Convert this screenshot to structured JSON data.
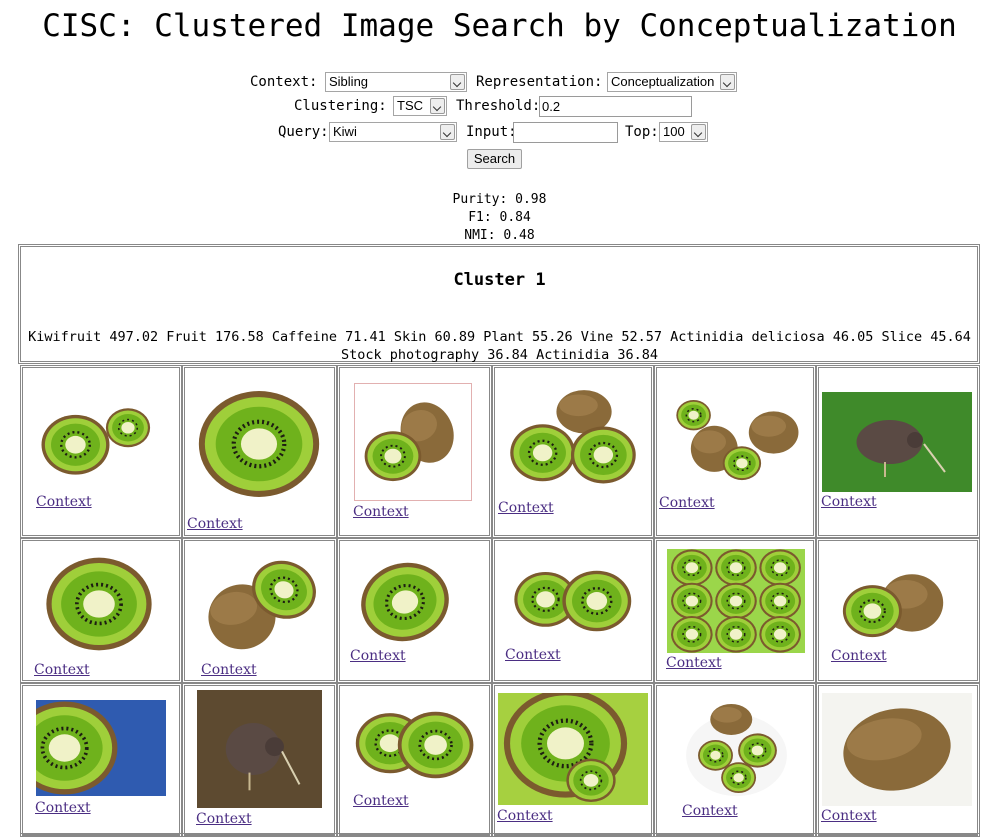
{
  "title": "CISC: Clustered Image Search by Conceptualization",
  "form": {
    "context_label": "Context:",
    "context_value": "Sibling",
    "representation_label": "Representation:",
    "representation_value": "Conceptualization",
    "clustering_label": "Clustering:",
    "clustering_value": "TSC",
    "threshold_label": "Threshold:",
    "threshold_value": "0.2",
    "query_label": "Query:",
    "query_value": "Kiwi",
    "input_label": "Input:",
    "input_value": "",
    "top_label": "Top:",
    "top_value": "100",
    "search_label": "Search"
  },
  "metrics": {
    "purity": "Purity: 0.98",
    "f1": "F1: 0.84",
    "nmi": "NMI: 0.48"
  },
  "cluster": {
    "title": "Cluster 1",
    "terms_line1": "Kiwifruit 497.02 Fruit 176.58 Caffeine 71.41 Skin 60.89 Plant 55.26 Vine 52.57 Actinidia deliciosa 46.05 Slice 45.64",
    "terms_line2": "Stock photography 36.84 Actinidia 36.84"
  },
  "results": {
    "link_label": "Context",
    "images": [
      "kiwi-halves",
      "kiwi-slice-closeup",
      "kiwi-whole-and-half",
      "kiwi-halves-group",
      "kiwi-group",
      "kiwi-bird",
      "kiwi-half-large",
      "kiwi-peeled",
      "kiwi-half-dark",
      "kiwi-two-halves",
      "kiwi-slices-pile",
      "kiwi-whole-and-half-2",
      "kiwi-slice-blue",
      "kiwi-bird-2",
      "kiwi-two-halves-2",
      "kiwi-slice-macro",
      "kiwi-plate",
      "kiwi-whole"
    ]
  },
  "colors": {
    "link": "#4b2e83",
    "kiwi_flesh": "#7cbf1e",
    "kiwi_skin": "#8a6a3a"
  }
}
